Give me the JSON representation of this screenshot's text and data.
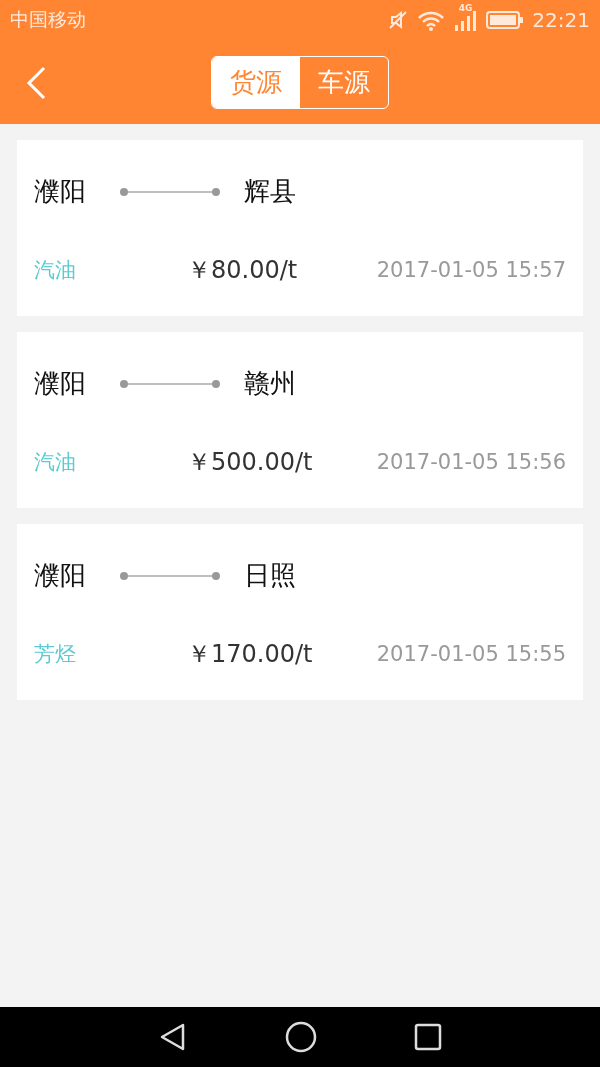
{
  "status_bar": {
    "carrier": "中国移动",
    "network": "4G",
    "time": "22:21"
  },
  "header": {
    "tabs": [
      {
        "label": "货源",
        "selected": true
      },
      {
        "label": "车源",
        "selected": false
      }
    ]
  },
  "listings": [
    {
      "origin": "濮阳",
      "destination": "辉县",
      "cargo": "汽油",
      "price": "￥80.00/t",
      "time": "2017-01-05 15:57"
    },
    {
      "origin": "濮阳",
      "destination": "赣州",
      "cargo": "汽油",
      "price": "￥500.00/t",
      "time": "2017-01-05 15:56"
    },
    {
      "origin": "濮阳",
      "destination": "日照",
      "cargo": "芳烃",
      "price": "￥170.00/t",
      "time": "2017-01-05 15:55"
    }
  ]
}
